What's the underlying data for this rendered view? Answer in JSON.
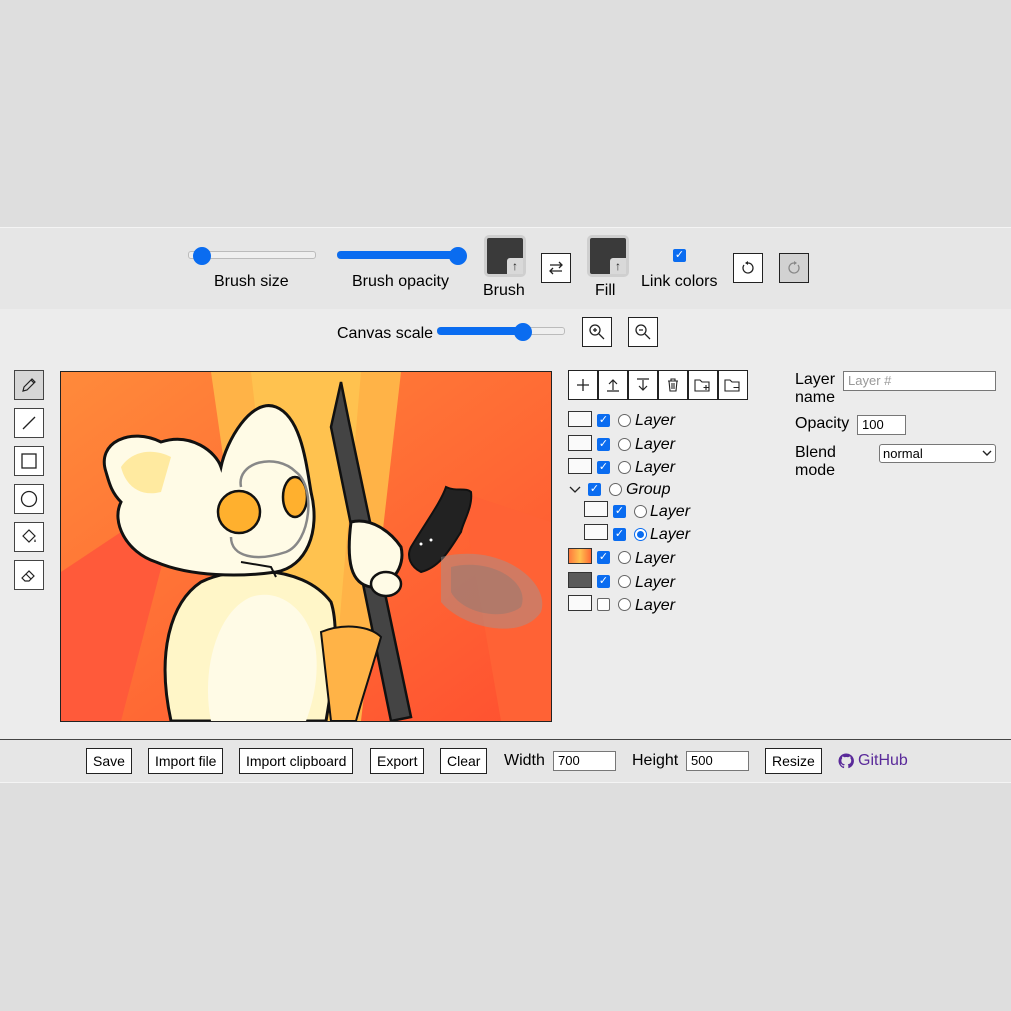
{
  "toolbar": {
    "brush_size_label": "Brush size",
    "brush_size_value": 0.05,
    "brush_opacity_label": "Brush opacity",
    "brush_opacity_value": 1.0,
    "brush_label": "Brush",
    "fill_label": "Fill",
    "link_colors_label": "Link colors",
    "link_colors_checked": true,
    "brush_color": "#3a3a3a",
    "fill_color": "#3a3a3a"
  },
  "scale": {
    "label": "Canvas scale",
    "value": 0.67
  },
  "tools": [
    "pencil-icon",
    "line-icon",
    "rectangle-icon",
    "circle-icon",
    "fill-bucket-icon",
    "eraser-icon"
  ],
  "layers": {
    "toolbar_icons": [
      "add-layer-icon",
      "move-up-icon",
      "move-down-icon",
      "delete-icon",
      "add-group-icon",
      "remove-group-icon"
    ],
    "items": [
      {
        "name": "Layer",
        "visible": true,
        "selected": false
      },
      {
        "name": "Layer",
        "visible": true,
        "selected": false
      },
      {
        "name": "Layer",
        "visible": true,
        "selected": false
      },
      {
        "name": "Group",
        "visible": true,
        "selected": false
      },
      {
        "name": "Layer",
        "visible": true,
        "selected": false
      },
      {
        "name": "Layer",
        "visible": true,
        "selected": true
      },
      {
        "name": "Layer",
        "visible": true,
        "selected": false
      },
      {
        "name": "Layer",
        "visible": true,
        "selected": false
      },
      {
        "name": "Layer",
        "visible": false,
        "selected": false
      }
    ]
  },
  "properties": {
    "layer_name_label": "Layer name",
    "layer_name_placeholder": "Layer #",
    "opacity_label": "Opacity",
    "opacity_value": "100",
    "blend_label": "Blend mode",
    "blend_value": "normal"
  },
  "footer": {
    "save": "Save",
    "import_file": "Import file",
    "import_clipboard": "Import clipboard",
    "export": "Export",
    "clear": "Clear",
    "width_label": "Width",
    "width_value": "700",
    "height_label": "Height",
    "height_value": "500",
    "resize": "Resize",
    "github": "GitHub",
    "link_color": "#5a2a9a"
  }
}
